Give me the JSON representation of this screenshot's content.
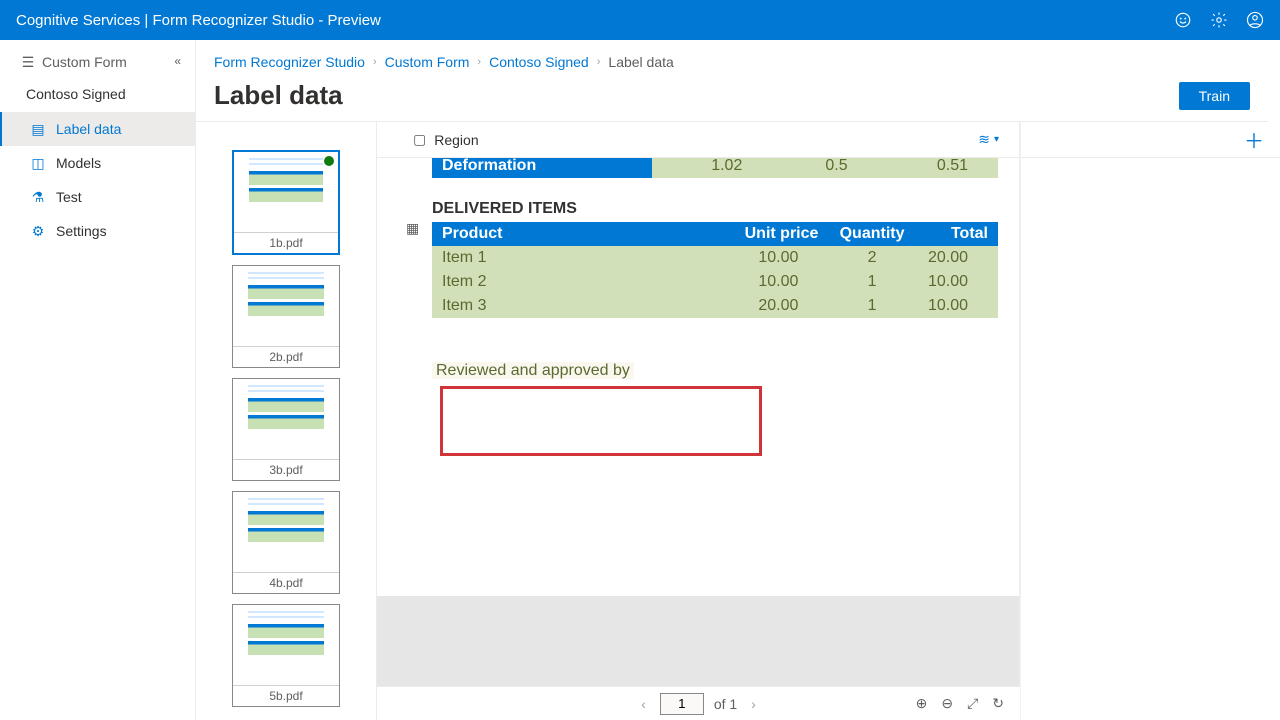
{
  "topbar": {
    "title": "Cognitive Services | Form Recognizer Studio - Preview"
  },
  "sidebar": {
    "project_label": "Custom Form",
    "project_name": "Contoso Signed",
    "items": [
      {
        "label": "Label data"
      },
      {
        "label": "Models"
      },
      {
        "label": "Test"
      },
      {
        "label": "Settings"
      }
    ]
  },
  "breadcrumbs": {
    "a": "Form Recognizer Studio",
    "b": "Custom Form",
    "c": "Contoso Signed",
    "d": "Label data"
  },
  "page": {
    "title": "Label data",
    "train": "Train"
  },
  "thumbs": [
    "1b.pdf",
    "2b.pdf",
    "3b.pdf",
    "4b.pdf",
    "5b.pdf"
  ],
  "toolbar": {
    "region": "Region"
  },
  "doc": {
    "truncated_header": "Deformation",
    "truncated_row": [
      "1.02",
      "0.5",
      "0.51"
    ],
    "section": "DELIVERED ITEMS",
    "cols": [
      "Product",
      "Unit price",
      "Quantity",
      "Total"
    ],
    "rows": [
      {
        "p": "Item 1",
        "u": "10.00",
        "q": "2",
        "t": "20.00"
      },
      {
        "p": "Item 2",
        "u": "10.00",
        "q": "1",
        "t": "10.00"
      },
      {
        "p": "Item 3",
        "u": "20.00",
        "q": "1",
        "t": "10.00"
      }
    ],
    "review": "Reviewed and approved by"
  },
  "pager": {
    "current": "1",
    "of": "of 1"
  }
}
